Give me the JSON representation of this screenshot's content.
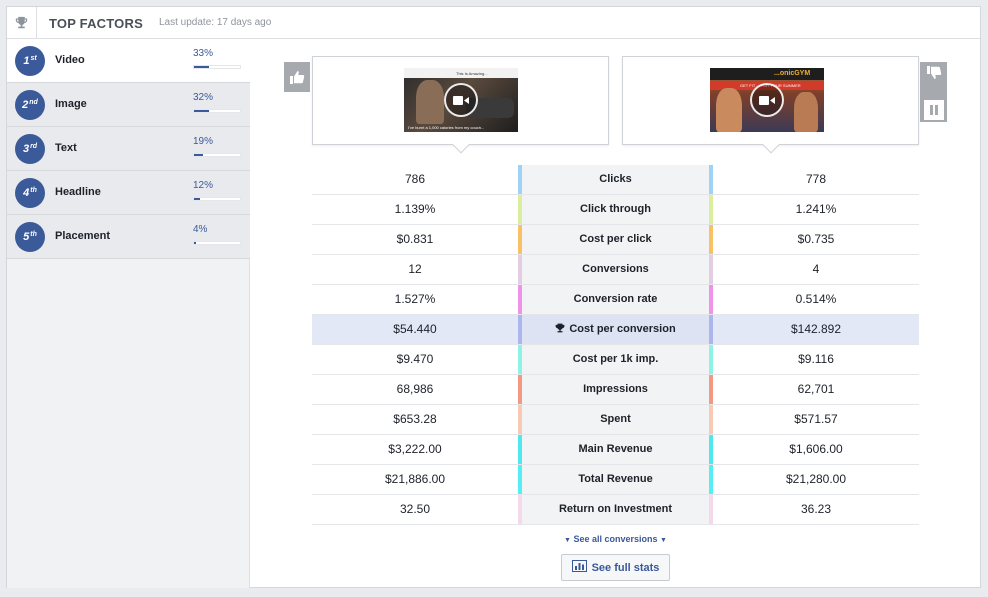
{
  "header": {
    "title": "TOP FACTORS",
    "last_update": "Last update: 17 days ago"
  },
  "factors": [
    {
      "rank": "1",
      "suffix": "st",
      "name": "Video",
      "percent_label": "33%",
      "percent": 33
    },
    {
      "rank": "2",
      "suffix": "nd",
      "name": "Image",
      "percent_label": "32%",
      "percent": 32
    },
    {
      "rank": "3",
      "suffix": "rd",
      "name": "Text",
      "percent_label": "19%",
      "percent": 19
    },
    {
      "rank": "4",
      "suffix": "th",
      "name": "Headline",
      "percent_label": "12%",
      "percent": 12
    },
    {
      "rank": "5",
      "suffix": "th",
      "name": "Placement",
      "percent_label": "4%",
      "percent": 4
    }
  ],
  "ads": {
    "left": {
      "caption_top": "This Is Amazing...",
      "caption_bottom": "I've burnt a 1,000 calories from my couch..."
    },
    "right": {
      "logo_text": "...onicGYM",
      "banner_text": "GET FIT ... FOR YOUR SUMMER"
    }
  },
  "metrics": [
    {
      "label": "Clicks",
      "a": "786",
      "b": "778",
      "color": "#9fd3f6"
    },
    {
      "label": "Click through",
      "a": "1.139%",
      "b": "1.241%",
      "color": "#d9ef9f"
    },
    {
      "label": "Cost per click",
      "a": "$0.831",
      "b": "$0.735",
      "color": "#f8c165"
    },
    {
      "label": "Conversions",
      "a": "12",
      "b": "4",
      "color": "#e4cde2"
    },
    {
      "label": "Conversion rate",
      "a": "1.527%",
      "b": "0.514%",
      "color": "#f192ea"
    },
    {
      "label": "Cost per conversion",
      "a": "$54.440",
      "b": "$142.892",
      "color": "#a9b7ec",
      "highlight": true
    },
    {
      "label": "Cost per 1k imp.",
      "a": "$9.470",
      "b": "$9.116",
      "color": "#8ff2e6"
    },
    {
      "label": "Impressions",
      "a": "68,986",
      "b": "62,701",
      "color": "#f29883"
    },
    {
      "label": "Spent",
      "a": "$653.28",
      "b": "$571.57",
      "color": "#f8c9b3"
    },
    {
      "label": "Main Revenue",
      "a": "$3,222.00",
      "b": "$1,606.00",
      "color": "#4fe8ee"
    },
    {
      "label": "Total Revenue",
      "a": "$21,886.00",
      "b": "$21,280.00",
      "color": "#52f0f4"
    },
    {
      "label": "Return on Investment",
      "a": "32.50",
      "b": "36.23",
      "color": "#f6d8ec"
    }
  ],
  "links": {
    "see_all": "See all conversions",
    "full_stats": "See full stats"
  },
  "colors": {
    "accent": "#3b5a9a",
    "link": "#3b5998",
    "highlight_row": "#e3e8f7"
  },
  "icons": [
    "trophy-icon",
    "thumbs-up-icon",
    "thumbs-down-icon",
    "pause-icon",
    "play-video-icon",
    "chart-icon",
    "caret-down-icon"
  ]
}
